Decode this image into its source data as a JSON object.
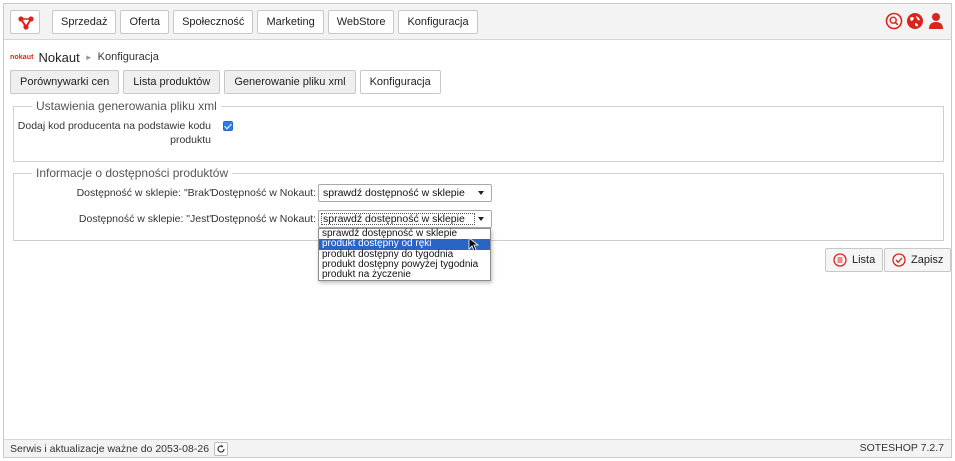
{
  "topbar": {
    "nav": [
      "Sprzedaż",
      "Oferta",
      "Społeczność",
      "Marketing",
      "WebStore",
      "Konfiguracja"
    ],
    "icons": [
      "search-icon",
      "globe-icon",
      "user-icon"
    ],
    "accent": "#d9251d"
  },
  "breadcrumb": {
    "logo_text": "nokaut",
    "title": "Nokaut",
    "separator": "►",
    "current": "Konfiguracja"
  },
  "tabs": [
    "Porównywarki cen",
    "Lista produktów",
    "Generowanie pliku xml",
    "Konfiguracja"
  ],
  "active_tab": "Konfiguracja",
  "section1": {
    "legend": "Ustawienia generowania pliku xml",
    "checkbox_label_line1": "Dodaj kod producenta na podstawie kodu",
    "checkbox_label_line2": "produktu",
    "checked": true
  },
  "section2": {
    "legend": "Informacje o dostępności produktów",
    "rows": [
      {
        "shop_label": "Dostępność w sklepie: \"Brak\"",
        "nokaut_label": "Dostępność w Nokaut:",
        "selected": "sprawdź dostępność w sklepie"
      },
      {
        "shop_label": "Dostępność w sklepie: \"Jest\"",
        "nokaut_label": "Dostępność w Nokaut:",
        "selected": "sprawdź dostępność w sklepie"
      }
    ]
  },
  "dropdown": {
    "options": [
      "sprawdź dostępność w sklepie",
      "produkt dostępny od ręki",
      "produkt dostępny do tygodnia",
      "produkt dostępny powyżej tygodnia",
      "produkt na życzenie"
    ],
    "highlighted": "produkt dostępny od ręki"
  },
  "actions": {
    "list_label": "Lista",
    "save_label": "Zapisz"
  },
  "footer": {
    "service_text": "Serwis i aktualizacje ważne do 2053-08-26",
    "version": "SOTESHOP 7.2.7"
  }
}
